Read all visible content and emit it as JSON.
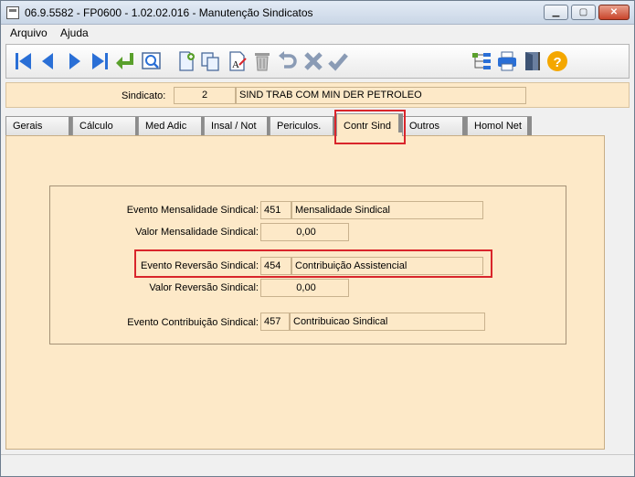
{
  "window": {
    "title": "06.9.5582 - FP0600 - 1.02.02.016 - Manutenção Sindicatos",
    "minimize_glyph": "▁",
    "maximize_glyph": "▢",
    "close_glyph": "✕"
  },
  "menu": {
    "arquivo": "Arquivo",
    "ajuda": "Ajuda"
  },
  "toolbar": {
    "icons": [
      "first-record-icon",
      "previous-record-icon",
      "next-record-icon",
      "last-record-icon",
      "return-icon",
      "preview-icon",
      "new-document-icon",
      "copy-icon",
      "text-edit-icon",
      "delete-icon",
      "undo-icon",
      "cancel-icon",
      "confirm-icon",
      "tree-structure-icon",
      "print-icon",
      "exit-door-icon",
      "help-icon"
    ]
  },
  "sindicato": {
    "label": "Sindicato:",
    "code": "2",
    "name": "SIND TRAB COM MIN DER PETROLEO"
  },
  "tabs": [
    {
      "label": "Gerais"
    },
    {
      "label": "Cálculo"
    },
    {
      "label": "Med Adic"
    },
    {
      "label": "Insal / Not"
    },
    {
      "label": "Periculos."
    },
    {
      "label": "Contr Sind",
      "active": true
    },
    {
      "label": "Outros"
    },
    {
      "label": "Homol Net"
    }
  ],
  "form": {
    "evento_mensalidade": {
      "label": "Evento Mensalidade Sindical:",
      "code": "451",
      "desc": "Mensalidade Sindical"
    },
    "valor_mensalidade": {
      "label": "Valor Mensalidade Sindical:",
      "value": "0,00"
    },
    "evento_reversao": {
      "label": "Evento Reversão Sindical:",
      "code": "454",
      "desc": "Contribuição Assistencial"
    },
    "valor_reversao": {
      "label": "Valor Reversão Sindical:",
      "value": "0,00"
    },
    "evento_contribuicao": {
      "label": "Evento Contribuição Sindical:",
      "code": "457",
      "desc": "Contribuicao Sindical"
    }
  },
  "colors": {
    "panel": "#fde9c8",
    "highlight": "#d9252b",
    "toolbar_blue": "#2a6fd6"
  }
}
